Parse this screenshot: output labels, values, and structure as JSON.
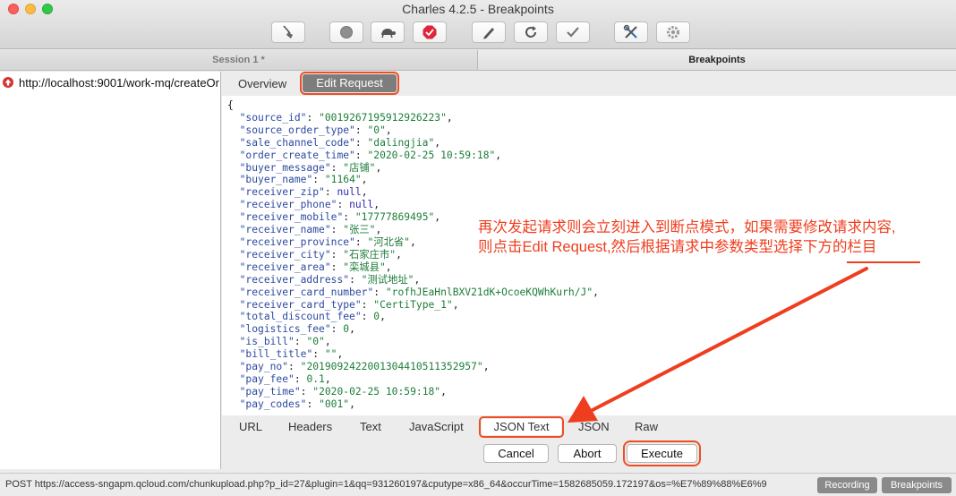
{
  "window": {
    "title": "Charles 4.2.5 - Breakpoints"
  },
  "toolbar": {
    "buttons": [
      {
        "icon": "broom-icon"
      },
      {
        "icon": "record-icon"
      },
      {
        "icon": "throttle-turtle-icon"
      },
      {
        "icon": "breakpoint-stop-icon"
      },
      {
        "icon": "pen-icon"
      },
      {
        "icon": "refresh-icon"
      },
      {
        "icon": "checkmark-icon"
      },
      {
        "icon": "tools-icon"
      },
      {
        "icon": "gear-icon"
      }
    ]
  },
  "tabs": {
    "session": "Session 1 *",
    "breakpoints": "Breakpoints"
  },
  "sidebar": {
    "items": [
      {
        "label": "http://localhost:9001/work-mq/createOr"
      }
    ]
  },
  "view_tabs": {
    "overview": "Overview",
    "edit_request": "Edit Request"
  },
  "json_body": {
    "open": "{",
    "lines": [
      {
        "key": "source_id",
        "value": "\"0019267195912926223\"",
        "type": "str"
      },
      {
        "key": "source_order_type",
        "value": "\"0\"",
        "type": "str"
      },
      {
        "key": "sale_channel_code",
        "value": "\"dalingjia\"",
        "type": "str"
      },
      {
        "key": "order_create_time",
        "value": "\"2020-02-25 10:59:18\"",
        "type": "str"
      },
      {
        "key": "buyer_message",
        "value": "\"店铺\"",
        "type": "str"
      },
      {
        "key": "buyer_name",
        "value": "\"1164\"",
        "type": "str"
      },
      {
        "key": "receiver_zip",
        "value": "null",
        "type": "null"
      },
      {
        "key": "receiver_phone",
        "value": "null",
        "type": "null"
      },
      {
        "key": "receiver_mobile",
        "value": "\"17777869495\"",
        "type": "str"
      },
      {
        "key": "receiver_name",
        "value": "\"张三\"",
        "type": "str"
      },
      {
        "key": "receiver_province",
        "value": "\"河北省\"",
        "type": "str"
      },
      {
        "key": "receiver_city",
        "value": "\"石家庄市\"",
        "type": "str"
      },
      {
        "key": "receiver_area",
        "value": "\"栾城县\"",
        "type": "str"
      },
      {
        "key": "receiver_address",
        "value": "\"测试地址\"",
        "type": "str"
      },
      {
        "key": "receiver_card_number",
        "value": "\"rofhJEaHnlBXV21dK+OcoeKQWhKurh/J\"",
        "type": "str"
      },
      {
        "key": "receiver_card_type",
        "value": "\"CertiType_1\"",
        "type": "str"
      },
      {
        "key": "total_discount_fee",
        "value": "0",
        "type": "num"
      },
      {
        "key": "logistics_fee",
        "value": "0",
        "type": "num"
      },
      {
        "key": "is_bill",
        "value": "\"0\"",
        "type": "str"
      },
      {
        "key": "bill_title",
        "value": "\"\"",
        "type": "str"
      },
      {
        "key": "pay_no",
        "value": "\"2019092422001304410511352957\"",
        "type": "str"
      },
      {
        "key": "pay_fee",
        "value": "0.1",
        "type": "num"
      },
      {
        "key": "pay_time",
        "value": "\"2020-02-25 10:59:18\"",
        "type": "str"
      },
      {
        "key": "pay_codes",
        "value": "\"001\"",
        "type": "str"
      }
    ]
  },
  "format_tabs": [
    "URL",
    "Headers",
    "Text",
    "JavaScript",
    "JSON Text",
    "JSON",
    "Raw"
  ],
  "actions": {
    "cancel": "Cancel",
    "abort": "Abort",
    "execute": "Execute"
  },
  "status": {
    "text": "POST https://access-sngapm.qcloud.com/chunkupload.php?p_id=27&plugin=1&qq=931260197&cputype=x86_64&occurTime=1582685059.172197&os=%E7%89%88%E6%9",
    "recording": "Recording",
    "breakpoints": "Breakpoints"
  },
  "annotation": {
    "line1": "再次发起请求则会立刻进入到断点模式，如果需要修改请求内容,",
    "line2": "则点击Edit Request,然后根据请求中参数类型选择下方的栏目",
    "color": "#ef3e1f"
  },
  "colors": {
    "highlight": "#ef4d23",
    "selected_tab": "#7d7d7d"
  }
}
